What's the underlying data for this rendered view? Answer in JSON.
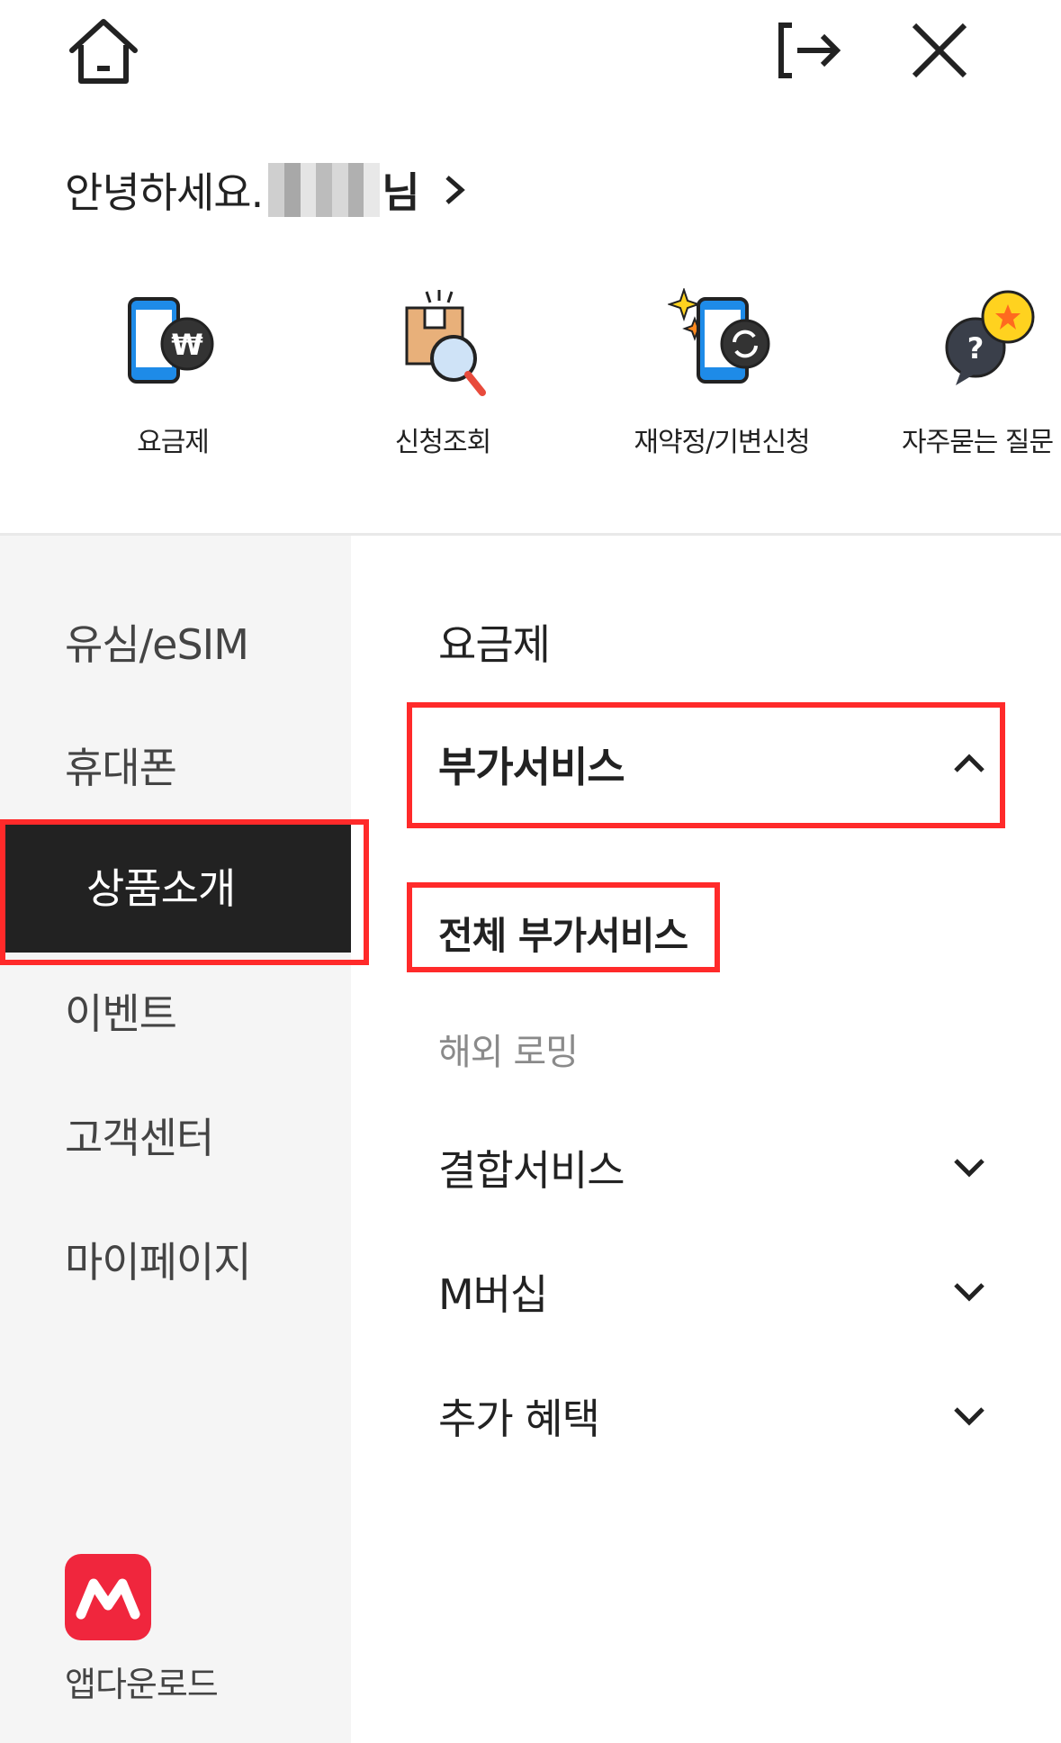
{
  "greeting": {
    "text": "안녕하세요.",
    "suffix": "님"
  },
  "shortcuts": [
    {
      "label": "요금제",
      "icon": "phone-won-icon"
    },
    {
      "label": "신청조회",
      "icon": "box-search-icon"
    },
    {
      "label": "재약정/기변신청",
      "icon": "phone-refresh-icon"
    },
    {
      "label": "자주묻는 질문",
      "icon": "question-star-bubble-icon"
    }
  ],
  "left_menu": [
    {
      "label": "유심/eSIM"
    },
    {
      "label": "휴대폰"
    },
    {
      "label": "상품소개",
      "active": true
    },
    {
      "label": "이벤트"
    },
    {
      "label": "고객센터"
    },
    {
      "label": "마이페이지"
    }
  ],
  "right_menu": {
    "plan": "요금제",
    "addon_service": "부가서비스",
    "all_addon": "전체 부가서비스",
    "roaming": "해외 로밍",
    "bundle": "결합서비스",
    "membership": "M버십",
    "benefits": "추가 혜택"
  },
  "app_download": {
    "label": "앱다운로드"
  },
  "colors": {
    "accent_red": "#ff2a2a",
    "brand": "#f0263d",
    "active_bg": "#222222",
    "left_bg": "#f5f5f5"
  }
}
